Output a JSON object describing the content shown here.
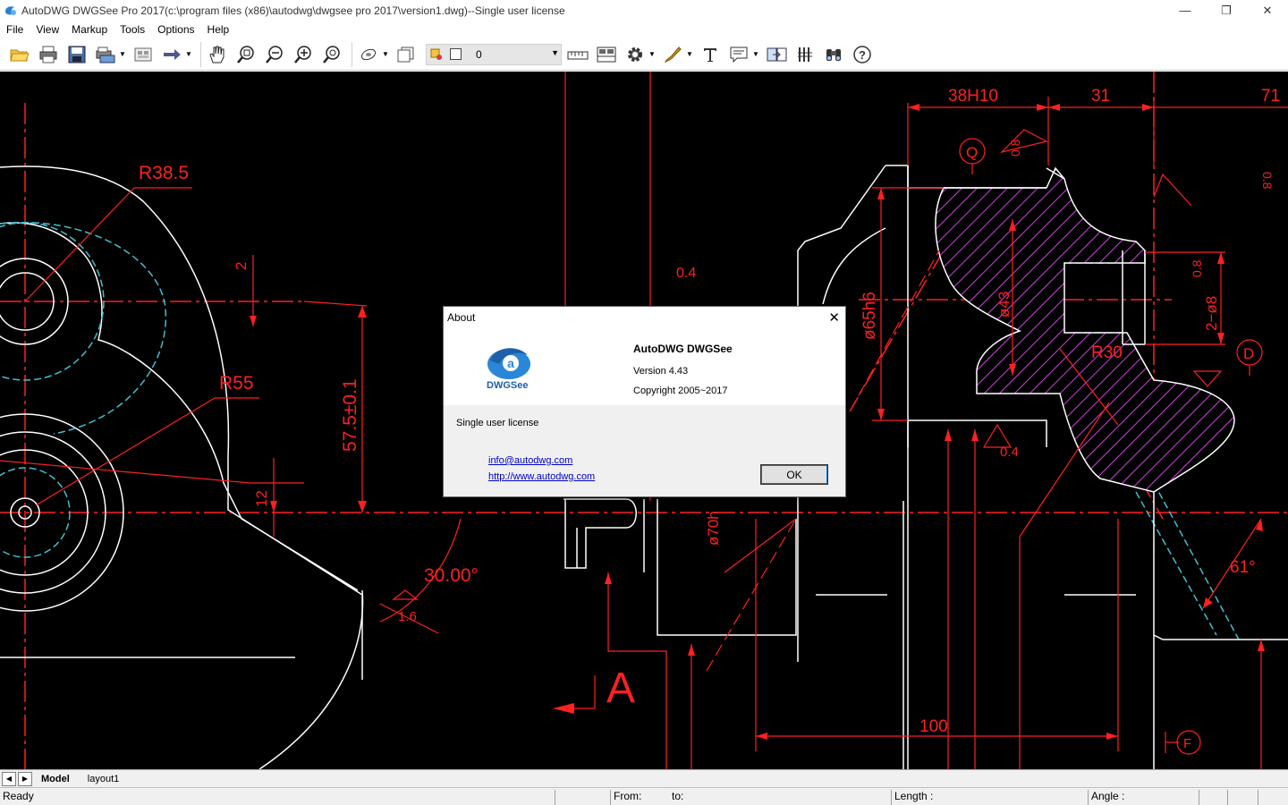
{
  "window": {
    "title": "AutoDWG DWGSee Pro 2017(c:\\program files (x86)\\autodwg\\dwgsee pro 2017\\version1.dwg)--Single user license",
    "controls": [
      "minimize-icon",
      "restore-icon",
      "close-icon"
    ]
  },
  "menu": [
    "File",
    "View",
    "Markup",
    "Tools",
    "Options",
    "Help"
  ],
  "toolbar": {
    "layer_value": "0",
    "buttons": [
      "open-icon",
      "print-icon",
      "save-icon",
      "batch-print-icon",
      "select-icon",
      "arrow-icon",
      "pan-icon",
      "zoom-window-icon",
      "zoom-out-icon",
      "zoom-in-icon",
      "zoom-extents-icon",
      "layers-icon",
      "3d-box-icon",
      "layer-props-icon",
      "measure-icon",
      "compare-icon",
      "settings-icon",
      "markup-pen-icon",
      "text-icon",
      "comment-icon",
      "convert-icon",
      "hatch-icon",
      "binoculars-icon",
      "help-icon"
    ]
  },
  "drawing": {
    "labels": {
      "r385": "R38.5",
      "r55": "R55",
      "dim2": "2",
      "dim575": "57.5±0.1",
      "dim12": "12",
      "angle30": "30.00°",
      "tol16": "1.6",
      "dim04a": "0.4",
      "sectionA": "A",
      "dim38h10": "38H10",
      "dim31": "31",
      "dim71": "71",
      "q": "Q",
      "tol08a": "0.8",
      "tol08b": "0.8",
      "dia65": "ø65h6",
      "dia43": "ø43",
      "r30": "R30",
      "dim04b": "0.4",
      "tol08c": "0.8",
      "dim2phi8": "2−ø8",
      "d": "D",
      "angle61": "61°",
      "dia70": "ø70h",
      "dim100": "100",
      "f": "F"
    }
  },
  "tabs": {
    "model": "Model",
    "layout1": "layout1"
  },
  "status": {
    "ready": "Ready",
    "from": "From:",
    "to": "to:",
    "length": "Length :",
    "angle": "Angle :"
  },
  "about_dialog": {
    "title": "About",
    "logo_text": "DWGSee",
    "product": "AutoDWG DWGSee",
    "version": "Version 4.43",
    "copyright": "Copyright 2005~2017",
    "license": "Single user license",
    "email": "info@autodwg.com",
    "website": "http://www.autodwg.com",
    "ok_label": "OK"
  },
  "colors": {
    "canvas_bg": "#000000",
    "dim_red": "#ff2020",
    "geometry_white": "#ffffff",
    "hidden_cyan": "#40c0d0",
    "hatch_magenta": "#d040e0"
  }
}
